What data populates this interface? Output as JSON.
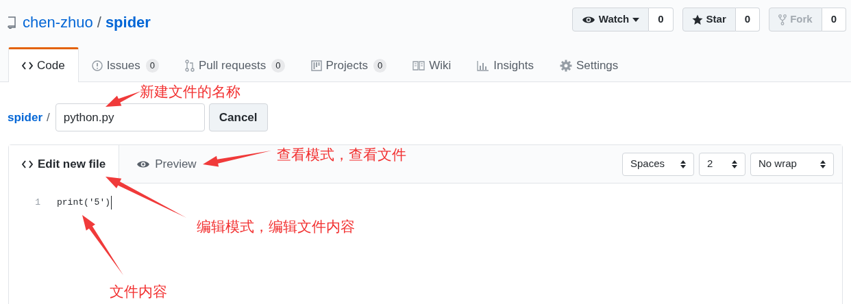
{
  "repo": {
    "owner": "chen-zhuo",
    "separator": "/",
    "name": "spider"
  },
  "actions": [
    {
      "label": "Watch",
      "count": "0",
      "disabled": false
    },
    {
      "label": "Star",
      "count": "0",
      "disabled": false
    },
    {
      "label": "Fork",
      "count": "0",
      "disabled": true
    }
  ],
  "tabs": [
    {
      "label": "Code",
      "selected": true
    },
    {
      "label": "Issues",
      "count": "0",
      "selected": false
    },
    {
      "label": "Pull requests",
      "count": "0",
      "selected": false
    },
    {
      "label": "Projects",
      "count": "0",
      "selected": false
    },
    {
      "label": "Wiki",
      "selected": false
    },
    {
      "label": "Insights",
      "selected": false
    },
    {
      "label": "Settings",
      "selected": false
    }
  ],
  "breadcrumb": {
    "repo": "spider",
    "separator": "/"
  },
  "filename": {
    "value": "python.py"
  },
  "cancel": "Cancel",
  "editor": {
    "tabs": [
      {
        "label": "Edit new file",
        "selected": true
      },
      {
        "label": "Preview",
        "selected": false
      }
    ],
    "selects": [
      "Spaces",
      "2",
      "No wrap"
    ],
    "lines": [
      {
        "number": "1",
        "code": "print('5')"
      }
    ]
  },
  "annotations": [
    "新建文件的名称",
    "查看模式，查看文件",
    "编辑模式，编辑文件内容",
    "文件内容"
  ]
}
